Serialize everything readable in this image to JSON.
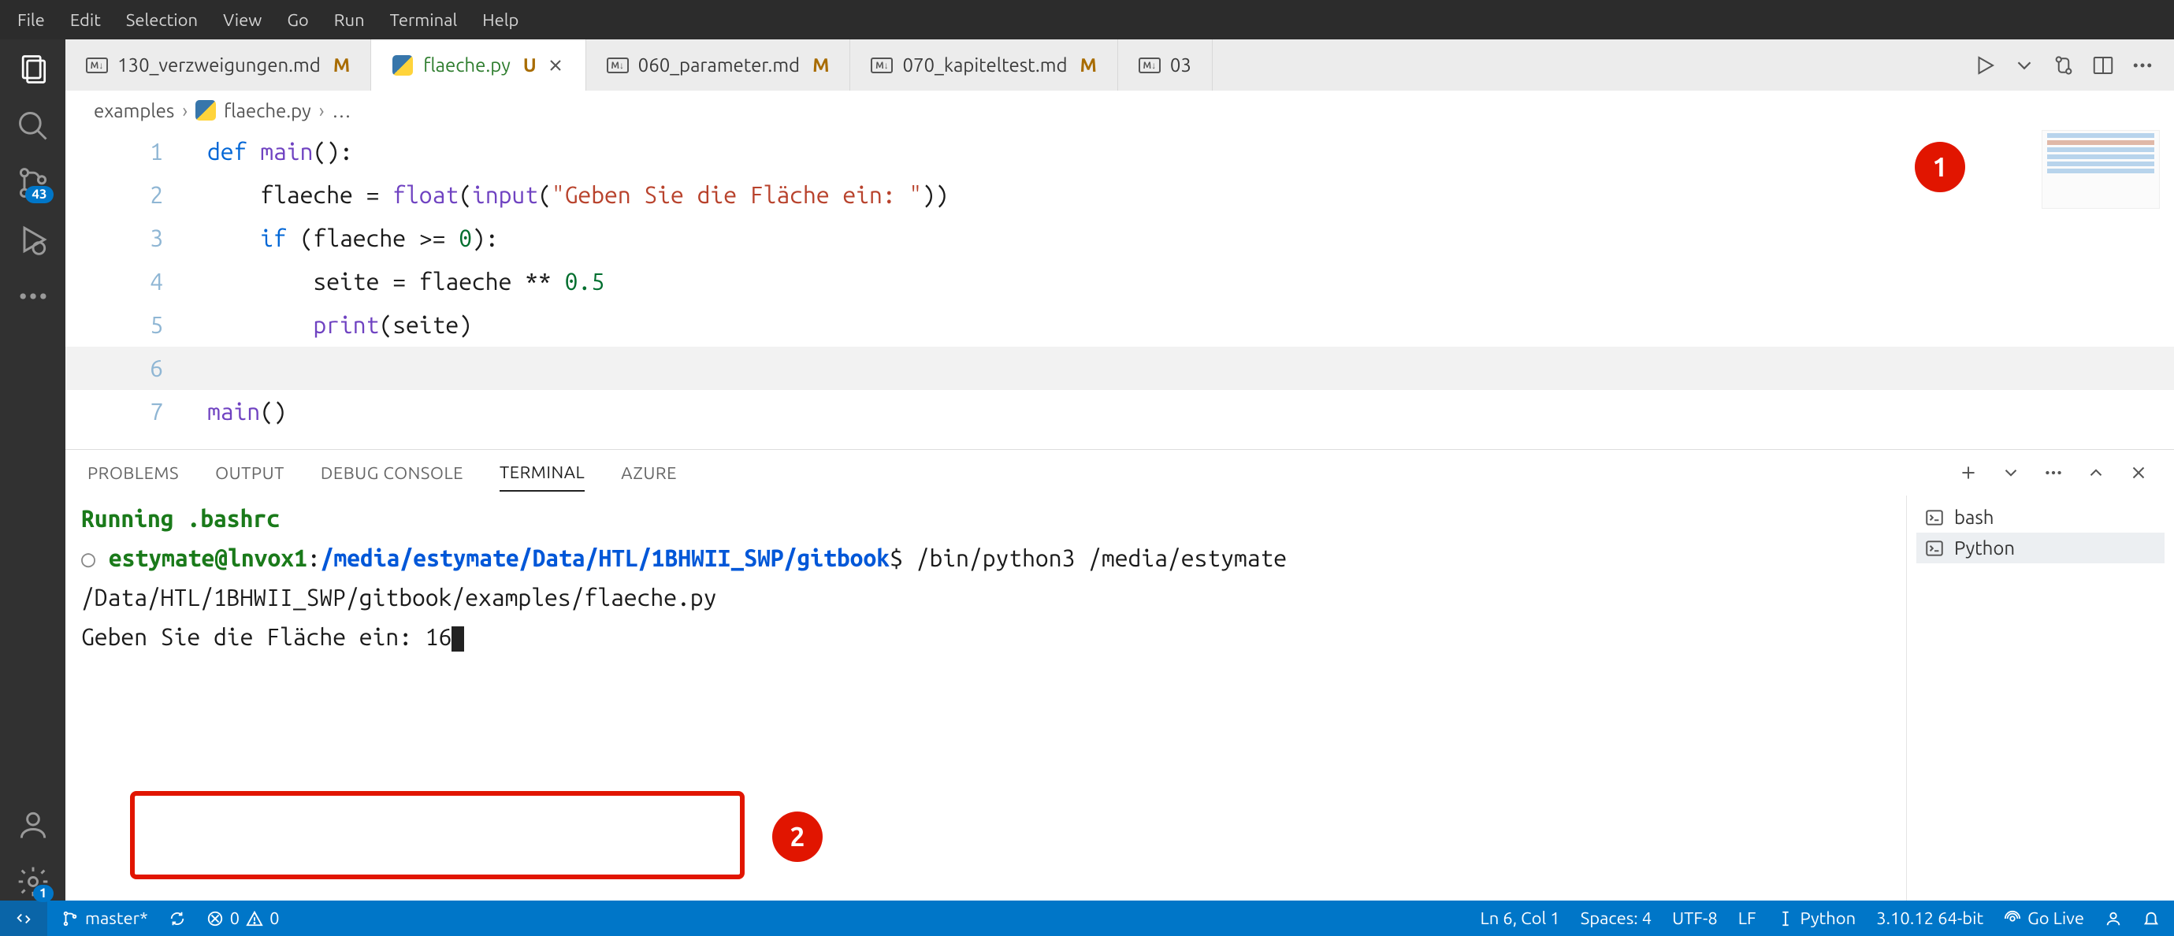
{
  "menubar": [
    "File",
    "Edit",
    "Selection",
    "View",
    "Go",
    "Run",
    "Terminal",
    "Help"
  ],
  "activitybar": {
    "scm_badge": "43",
    "settings_badge": "1"
  },
  "tabs": [
    {
      "icon": "md",
      "label": "130_verzweigungen.md",
      "mod": "M"
    },
    {
      "icon": "py",
      "label": "flaeche.py",
      "mod": "U",
      "active": true,
      "close": true
    },
    {
      "icon": "md",
      "label": "060_parameter.md",
      "mod": "M"
    },
    {
      "icon": "md",
      "label": "070_kapiteltest.md",
      "mod": "M"
    },
    {
      "icon": "md",
      "label": "03",
      "overflow": true
    }
  ],
  "breadcrumb": {
    "folder": "examples",
    "file": "flaeche.py",
    "rest": "…"
  },
  "code": {
    "lines": [
      {
        "n": "1",
        "html": "<span class='tok-kw'>def</span> <span class='tok-fn'>main</span>():"
      },
      {
        "n": "2",
        "html": "    flaeche = <span class='tok-bfn'>float</span>(<span class='tok-bfn'>input</span>(<span class='tok-str'>\"Geben Sie die Fläche ein: \"</span>))"
      },
      {
        "n": "3",
        "html": "    <span class='tok-kw'>if</span> (flaeche &gt;= <span class='tok-num'>0</span>):"
      },
      {
        "n": "4",
        "html": "        seite = flaeche ** <span class='tok-num'>0.5</span>"
      },
      {
        "n": "5",
        "html": "        <span class='tok-bfn'>print</span>(seite)"
      },
      {
        "n": "6",
        "html": "",
        "current": true
      },
      {
        "n": "7",
        "html": "<span class='tok-fn'>main</span>()"
      }
    ]
  },
  "panel": {
    "tabs": [
      "PROBLEMS",
      "OUTPUT",
      "DEBUG CONSOLE",
      "TERMINAL",
      "AZURE"
    ],
    "active": "TERMINAL"
  },
  "terminal": {
    "line1": "Running .bashrc",
    "prompt_user": "estymate@lnvox1",
    "prompt_path": "/media/estymate/Data/HTL/1BHWII_SWP/gitbook",
    "cmd1": "$ /bin/python3 /media/estymate",
    "cmd2": "/Data/HTL/1BHWII_SWP/gitbook/examples/flaeche.py",
    "input_prompt": "Geben Sie die Fläche ein: 16",
    "sessions": [
      {
        "label": "bash",
        "active": false
      },
      {
        "label": "Python",
        "active": true
      }
    ]
  },
  "annotations": {
    "c1": "1",
    "c2": "2"
  },
  "statusbar": {
    "branch": "master*",
    "errors": "0",
    "warnings": "0",
    "cursor": "Ln 6, Col 1",
    "spaces": "Spaces: 4",
    "encoding": "UTF-8",
    "eol": "LF",
    "lang": "Python",
    "pyver": "3.10.12 64-bit",
    "golive": "Go Live"
  }
}
